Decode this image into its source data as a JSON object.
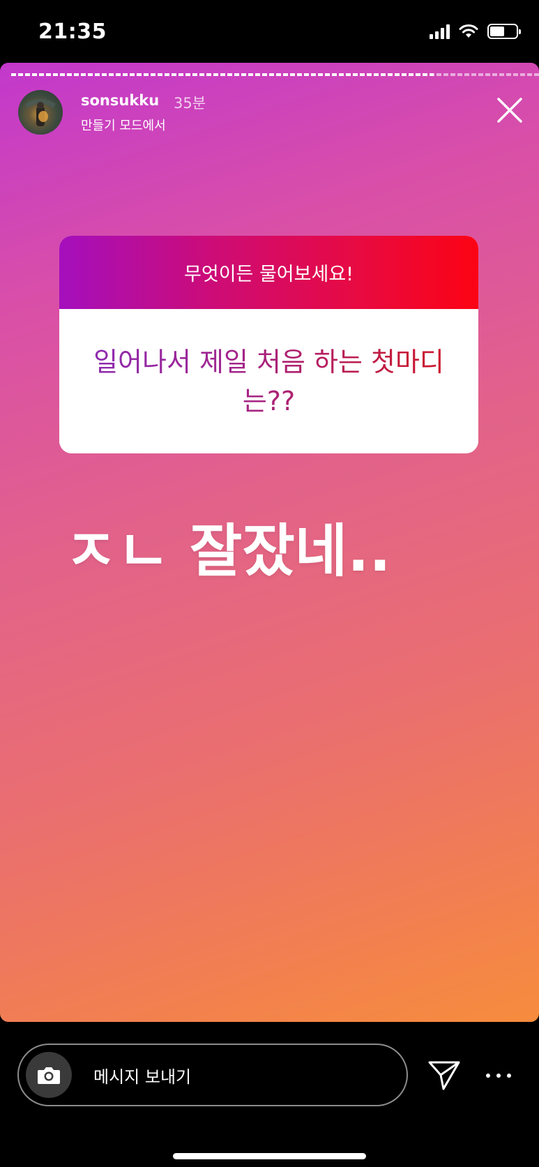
{
  "status_bar": {
    "time": "21:35",
    "battery_level": 0.55,
    "icons": [
      "signal-icon",
      "wifi-icon",
      "battery-icon"
    ]
  },
  "story": {
    "progress": 0.8,
    "author": {
      "username": "sonsukku",
      "posted_ago": "35분",
      "subtitle": "만들기 모드에서"
    },
    "question_sticker": {
      "prompt": "무엇이든 물어보세요!",
      "question": "일어나서 제일 처음 하는 첫마디는??"
    },
    "answer": "ㅈㄴ 잘잤네..",
    "colors": {
      "gradient_start": "#c238cc",
      "gradient_end": "#f68c3d",
      "sticker_header_start": "#a40fbd",
      "sticker_header_end": "#fc0314"
    }
  },
  "bottom_bar": {
    "message_placeholder": "메시지 보내기",
    "icons": [
      "camera-icon",
      "send-icon",
      "more-icon"
    ]
  }
}
